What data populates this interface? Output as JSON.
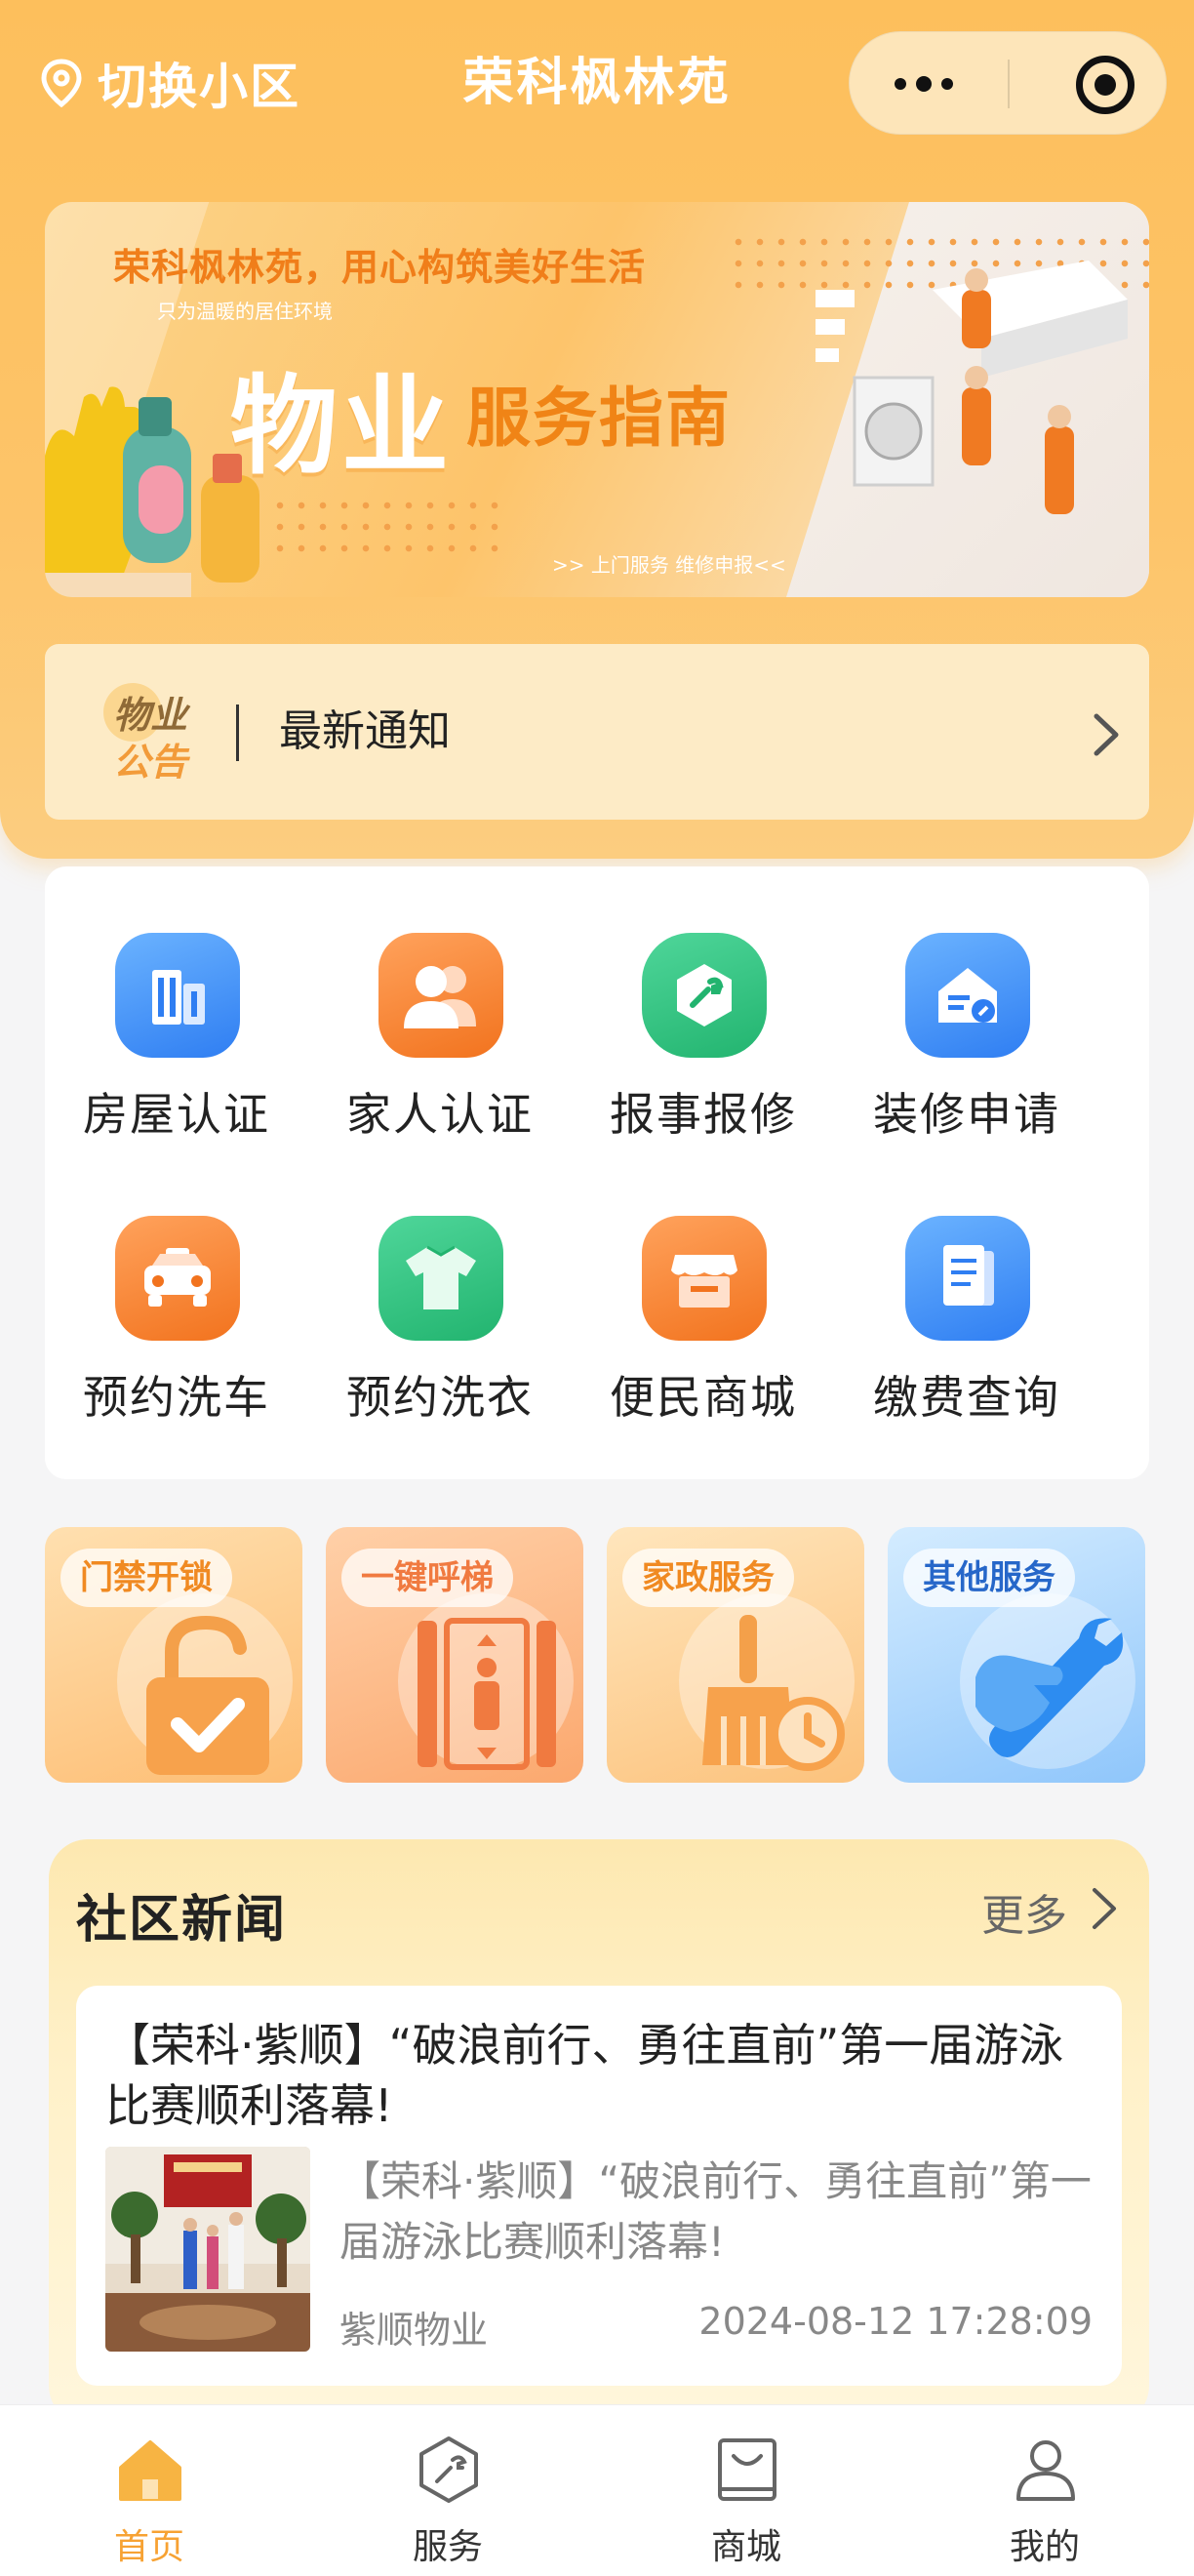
{
  "navbar": {
    "switch_label": "切换小区",
    "title": "荣科枫林苑"
  },
  "banner": {
    "slogan": "荣科枫林苑，用心构筑美好生活",
    "sub": "只为温暖的居住环境",
    "title_big": "物业",
    "title_small": "服务指南",
    "hint": ">> 上门服务   维修申报<<"
  },
  "notice": {
    "logo_line1": "物业",
    "logo_line2": "公告",
    "text": "最新通知"
  },
  "services": [
    {
      "label": "房屋认证",
      "icon": "building-icon",
      "color": "#2f7ef2"
    },
    {
      "label": "家人认证",
      "icon": "family-icon",
      "color": "#f2731e"
    },
    {
      "label": "报事报修",
      "icon": "wrench-icon",
      "color": "#22b46f"
    },
    {
      "label": "装修申请",
      "icon": "house-edit-icon",
      "color": "#2f7ef2"
    },
    {
      "label": "预约洗车",
      "icon": "car-icon",
      "color": "#f2731e"
    },
    {
      "label": "预约洗衣",
      "icon": "shirt-icon",
      "color": "#22b46f"
    },
    {
      "label": "便民商城",
      "icon": "store-icon",
      "color": "#f2731e"
    },
    {
      "label": "缴费查询",
      "icon": "document-icon",
      "color": "#2f7ef2"
    }
  ],
  "quick_tiles": [
    {
      "label": "门禁开锁",
      "icon": "lock-icon"
    },
    {
      "label": "一键呼梯",
      "icon": "elevator-icon"
    },
    {
      "label": "家政服务",
      "icon": "broom-icon"
    },
    {
      "label": "其他服务",
      "icon": "hand-wrench-icon"
    }
  ],
  "news": {
    "title": "社区新闻",
    "more": "更多",
    "items": [
      {
        "headline": "【荣科·紫顺】“破浪前行、勇往直前”第一届游泳比赛顺利落幕!",
        "summary": "【荣科·紫顺】“破浪前行、勇往直前”第一届游泳比赛顺利落幕!",
        "source": "紫顺物业",
        "time": "2024-08-12 17:28:09"
      }
    ]
  },
  "tabbar": [
    {
      "label": "首页",
      "icon": "home-icon",
      "active": true
    },
    {
      "label": "服务",
      "icon": "wrench-tab-icon",
      "active": false
    },
    {
      "label": "商城",
      "icon": "shop-bag-icon",
      "active": false
    },
    {
      "label": "我的",
      "icon": "person-icon",
      "active": false
    }
  ],
  "colors": {
    "primary": "#fdbf5c",
    "accent": "#f7a233",
    "blue": "#2f7ef2",
    "orange": "#f2731e",
    "green": "#22b46f"
  }
}
